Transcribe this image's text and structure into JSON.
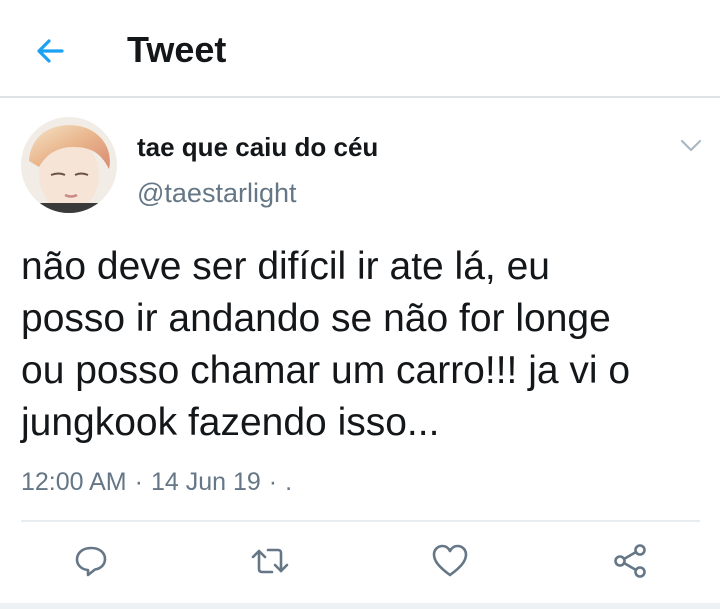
{
  "header": {
    "title": "Tweet"
  },
  "tweet": {
    "display_name": "tae que caiu do céu",
    "handle": "@taestarlight",
    "text": "não deve ser difícil ir ate lá, eu\nposso ir andando se não for longe\nou posso chamar um carro!!! ja vi o\njungkook fazendo isso...",
    "time": "12:00 AM",
    "date": "14 Jun 19",
    "separator": "·",
    "trailing": "·",
    "source": "."
  },
  "colors": {
    "accent": "#1da1f2",
    "text_primary": "#14171a",
    "text_secondary": "#657786",
    "divider": "#e6ecf0"
  },
  "icons": {
    "back": "arrow-left-icon",
    "caret": "chevron-down-icon",
    "reply": "reply-icon",
    "retweet": "retweet-icon",
    "like": "heart-icon",
    "share": "share-icon"
  }
}
